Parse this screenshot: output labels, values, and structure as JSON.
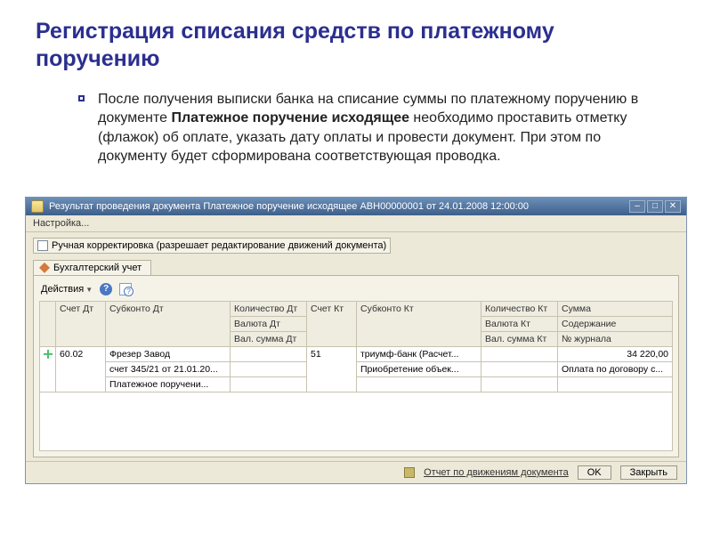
{
  "heading": "Регистрация списания средств по платежному поручению",
  "body": {
    "part1": "После получения выписки банка на списание суммы по платежному поручению в документе ",
    "bold1": "Платежное поручение исходящее",
    "part2": " необходимо проставить отметку (флажок) об оплате, указать дату оплаты и провести документ. При этом по документу будет сформирована соответствующая проводка."
  },
  "window": {
    "title": "Результат проведения документа Платежное поручение исходящее АВН00000001 от 24.01.2008 12:00:00",
    "menu": "Настройка...",
    "checkbox_label": "Ручная корректировка (разрешает редактирование движений документа)",
    "tab_label": "Бухгалтерский учет",
    "actions_label": "Действия",
    "headers": {
      "r1": [
        "",
        "Счет Дт",
        "Субконто Дт",
        "Количество Дт",
        "Счет Кт",
        "Субконто Кт",
        "Количество Кт",
        "Сумма"
      ],
      "r2": [
        "",
        "",
        "",
        "Валюта Дт",
        "",
        "",
        "Валюта Кт",
        "Содержание"
      ],
      "r3": [
        "",
        "",
        "",
        "Вал. сумма Дт",
        "",
        "",
        "Вал. сумма Кт",
        "№ журнала"
      ]
    },
    "row": {
      "счет_дт": "60.02",
      "субконто_дт_1": "Фрезер Завод",
      "субконто_дт_2": "счет 345/21 от 21.01.20...",
      "субконто_дт_3": "Платежное поручени...",
      "счет_кт": "51",
      "субконто_кт_1": "триумф-банк (Расчет...",
      "субконто_кт_2": "Приобретение объек...",
      "сумма": "34 220,00",
      "содержание": "Оплата по договору с..."
    },
    "footer": {
      "report": "Отчет по движениям документа",
      "ok": "OK",
      "close": "Закрыть"
    }
  }
}
